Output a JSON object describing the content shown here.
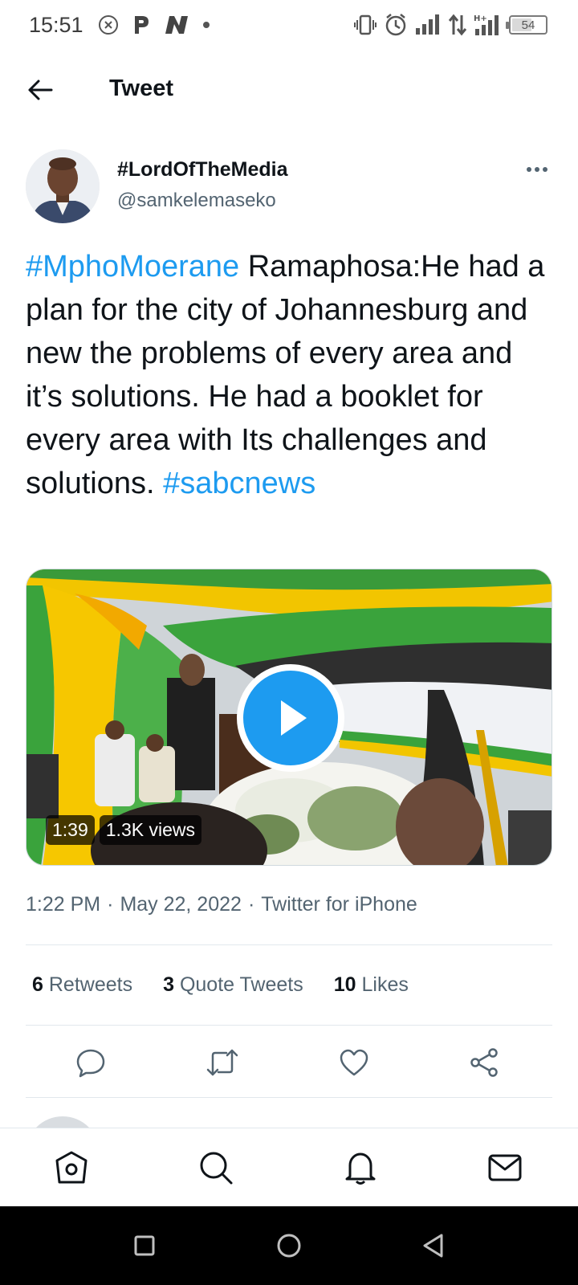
{
  "status_bar": {
    "time": "15:51",
    "battery_level": "54",
    "icons": [
      "close-circle-icon",
      "parking-icon",
      "n-app-icon",
      "dot-icon",
      "vibrate-icon",
      "alarm-icon",
      "signal-icon",
      "data-arrows-icon",
      "hplus-signal-icon",
      "battery-icon"
    ]
  },
  "header": {
    "title": "Tweet",
    "back_icon": "arrow-left-icon"
  },
  "author": {
    "display_name": "#LordOfTheMedia",
    "handle": "@samkelemaseko",
    "more_icon": "more-horizontal-icon"
  },
  "tweet": {
    "hashtag_1": "#MphoMoerane",
    "body": " Ramaphosa:He had a plan for the city of Johannesburg and new the problems of every area and it’s solutions. He had a booklet for every area with Its challenges and solutions. ",
    "hashtag_2": "#sabcnews"
  },
  "media": {
    "duration": "1:39",
    "views": "1.3K views",
    "play_icon": "play-icon"
  },
  "meta": {
    "time": "1:22 PM",
    "separator": "·",
    "date": "May 22, 2022",
    "source": "Twitter for iPhone"
  },
  "stats": {
    "retweets_count": "6",
    "retweets_label": "Retweets",
    "quotes_count": "3",
    "quotes_label": "Quote Tweets",
    "likes_count": "10",
    "likes_label": "Likes"
  },
  "actions": [
    "reply-icon",
    "retweet-icon",
    "like-icon",
    "share-icon"
  ],
  "bottom_nav": [
    "home-icon",
    "search-icon",
    "notifications-icon",
    "messages-icon"
  ],
  "system_nav": [
    "recent-apps-icon",
    "home-circle-icon",
    "back-triangle-icon"
  ],
  "colors": {
    "accent": "#1d9bf0",
    "text_primary": "#0f1419",
    "text_secondary": "#536471"
  }
}
